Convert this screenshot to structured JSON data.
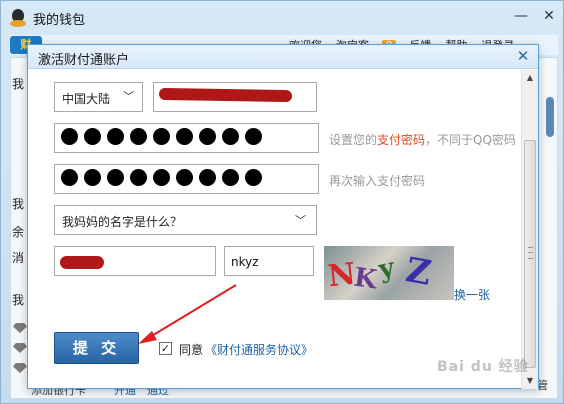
{
  "window": {
    "title": "我的钱包",
    "min_icon": "minimize-icon",
    "close_icon": "close-icon"
  },
  "topbar": {
    "logo": "财",
    "links": [
      "欢迎您",
      "淘宝客",
      "反馈",
      "帮助",
      "退登录"
    ],
    "badge": "0"
  },
  "background": {
    "side_labels": [
      "我",
      "我",
      "余",
      "消",
      "我"
    ],
    "footer_links": [
      "添加银行卡",
      "开通",
      "通过"
    ],
    "right_label": "管"
  },
  "dialog": {
    "title": "激活财付通账户",
    "region": {
      "value": "中国大陆",
      "icon": "chevron-down-icon"
    },
    "password_hint_prefix": "设置您的",
    "password_hint_link": "支付密码",
    "password_hint_suffix": "，不同于QQ密码",
    "confirm_hint": "再次输入支付密码",
    "security_question": "我妈妈的名字是什么？",
    "captcha_value": "nkyz",
    "captcha_image_text": "NKyZ",
    "refresh_link": "换一张",
    "submit_label": "提 交",
    "agree_text": "同意",
    "agree_link": "《财付通服务协议》",
    "agree_checked": true
  },
  "watermark": "Bai du 经验",
  "colors": {
    "accent": "#2964a6",
    "link": "#1b63a8",
    "highlight": "#e0491f",
    "annotation": "#e02020"
  }
}
